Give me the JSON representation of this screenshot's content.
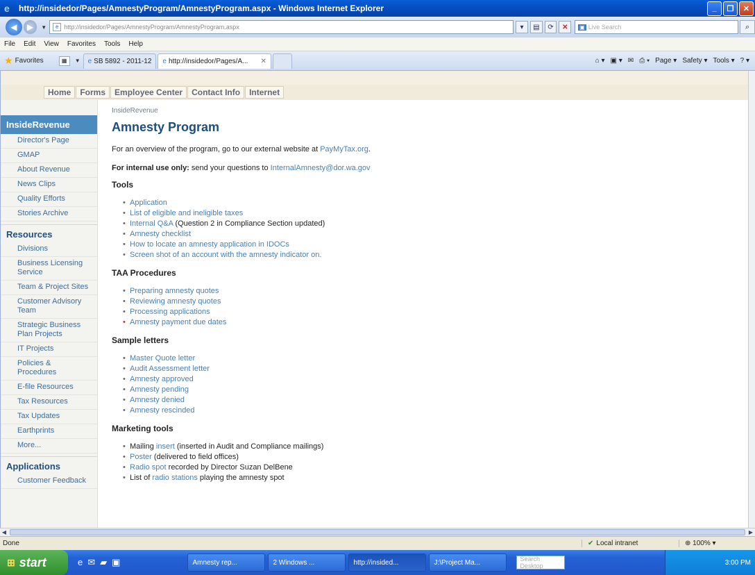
{
  "window": {
    "title": "http://insidedor/Pages/AmnestyProgram/AmnestyProgram.aspx - Windows Internet Explorer",
    "address": "http://insidedor/Pages/AmnestyProgram/AmnestyProgram.aspx",
    "search_placeholder": "Live Search",
    "menu": [
      "File",
      "Edit",
      "View",
      "Favorites",
      "Tools",
      "Help"
    ],
    "favorites_label": "Favorites",
    "tabs": [
      {
        "label": "SB 5892 - 2011-12"
      },
      {
        "label": "http://insidedor/Pages/A...",
        "active": true
      }
    ],
    "command_bar": [
      "Page ▾",
      "Safety ▾",
      "Tools ▾"
    ]
  },
  "site_nav": [
    "Home",
    "Forms",
    "Employee Center",
    "Contact Info",
    "Internet"
  ],
  "sidebar": {
    "section1_title": "InsideRevenue",
    "section1_items": [
      "Director's Page",
      "GMAP",
      "About Revenue",
      "News Clips",
      "Quality Efforts",
      "Stories Archive"
    ],
    "section2_title": "Resources",
    "section2_items": [
      "Divisions",
      "Business Licensing Service",
      "Team & Project Sites",
      "Customer Advisory Team",
      "Strategic Business Plan Projects",
      "IT Projects",
      "Policies & Procedures",
      "E-file Resources",
      "Tax Resources",
      "Tax Updates",
      "Earthprints",
      "More..."
    ],
    "section3_title": "Applications",
    "section3_items": [
      "Customer Feedback"
    ]
  },
  "main": {
    "breadcrumb": "InsideRevenue",
    "title": "Amnesty Program",
    "intro_text": "For an overview of the program, go to our external website at",
    "intro_link": "PayMyTax.org",
    "internal_bold": "For internal use only:",
    "internal_text": "send your questions to",
    "internal_link": "InternalAmnesty@dor.wa.gov",
    "tools_heading": "Tools",
    "tools": [
      "Application",
      "List of eligible and ineligible taxes",
      "Internal Q&A",
      "Amnesty checklist",
      "How to locate an amnesty application in IDOCs",
      "Screen shot of an account with the amnesty indicator on."
    ],
    "tools_qa_note": "(Question 2 in Compliance Section updated)",
    "taa_heading": "TAA Procedures",
    "taa": [
      "Preparing amnesty quotes",
      "Reviewing amnesty quotes",
      "Processing applications",
      "Amnesty payment due dates"
    ],
    "letters_heading": "Sample letters",
    "letters": [
      "Master Quote letter",
      "Audit Assessment letter",
      "Amnesty approved",
      "Amnesty pending",
      "Amnesty denied",
      "Amnesty rescinded"
    ],
    "marketing_heading": "Marketing tools",
    "marketing": {
      "m1_pre": "Mailing",
      "m1_link": "insert",
      "m1_post": "(inserted in Audit and Compliance mailings)",
      "m2_link": "Poster",
      "m2_post": "(delivered to field offices)",
      "m3_link": "Radio spot",
      "m3_post": "recorded by Director Suzan DelBene",
      "m4_pre": "List of",
      "m4_link": "radio stations",
      "m4_post": "playing the amnesty spot"
    }
  },
  "status": {
    "left": "Done",
    "zone": "Local intranet",
    "zoom": "100%"
  },
  "taskbar": {
    "start": "start",
    "buttons": [
      "Amnesty rep...",
      "2 Windows ...",
      "http://insided...",
      "J:\\Project Ma..."
    ],
    "search": "Search Desktop",
    "clock": "3:00 PM"
  },
  "colors": {
    "accent": "#4b8bbd",
    "link": "#4a7fb0",
    "title": "#1d4e7e"
  }
}
